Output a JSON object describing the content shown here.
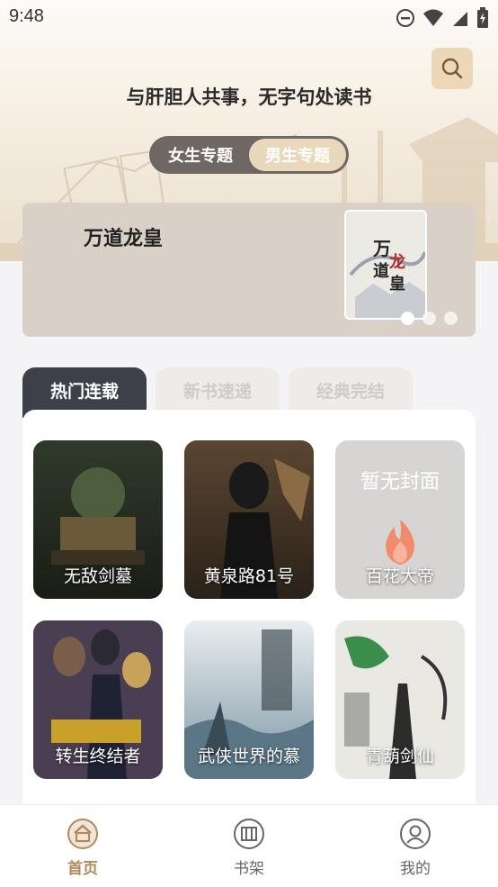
{
  "status_bar": {
    "time": "9:48"
  },
  "header": {
    "slogan": "与肝胆人共事，无字句处读书"
  },
  "gender_switch": {
    "female": "女生专题",
    "male": "男生专题",
    "selected": "male"
  },
  "banner": {
    "title": "万道龙皇",
    "cover_title": "万道龙皇",
    "slide_count": 3,
    "active_slide": 0
  },
  "tabs": [
    {
      "label": "热门连载",
      "active": true
    },
    {
      "label": "新书速递",
      "active": false
    },
    {
      "label": "经典完结",
      "active": false
    }
  ],
  "books": [
    {
      "title": "无敌剑墓",
      "cover": "green-dark"
    },
    {
      "title": "黄泉路81号",
      "cover": "brown-dark"
    },
    {
      "title": "百花大帝",
      "cover": "none",
      "placeholder": "暂无封面"
    },
    {
      "title": "转生终结者",
      "cover": "purple"
    },
    {
      "title": "武侠世界的慕",
      "cover": "blue-mist"
    },
    {
      "title": "青葫剑仙",
      "cover": "ink-grey"
    }
  ],
  "bottom_nav": [
    {
      "label": "首页",
      "icon": "home-icon",
      "active": true
    },
    {
      "label": "书架",
      "icon": "bookshelf-icon",
      "active": false
    },
    {
      "label": "我的",
      "icon": "profile-icon",
      "active": false
    }
  ],
  "colors": {
    "accent": "#b08a5c",
    "tab_active": "#3e4049",
    "switch_active": "#e9d9bc"
  }
}
